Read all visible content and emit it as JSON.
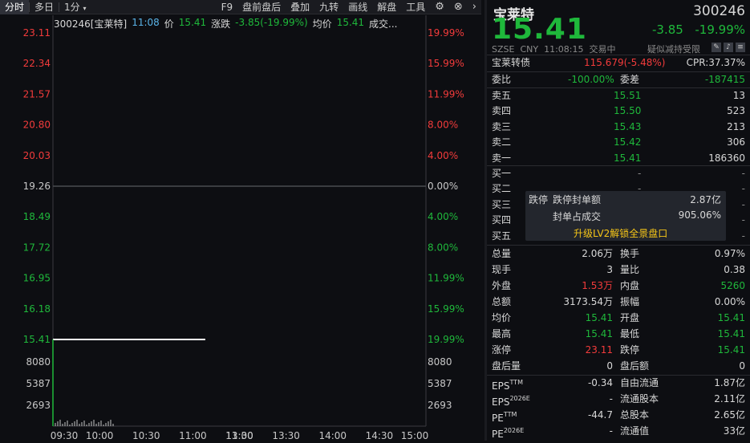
{
  "toolbar": {
    "tabs": [
      "分时",
      "多日",
      "1分"
    ],
    "items": [
      "F9",
      "盘前盘后",
      "叠加",
      "九转",
      "画线",
      "解盘",
      "工具"
    ]
  },
  "info_bar": {
    "name": "300246[宝莱特]",
    "time": "11:08",
    "price_label": "价",
    "price": "15.41",
    "change_label": "涨跌",
    "change": "-3.85(-19.99%)",
    "avg_label": "均价",
    "avg": "15.41",
    "vol_label": "成交..."
  },
  "chart_data": {
    "type": "line",
    "price_ticks": [
      "23.11",
      "22.34",
      "21.57",
      "20.80",
      "20.03",
      "19.26",
      "18.49",
      "17.72",
      "16.95",
      "16.18",
      "15.41"
    ],
    "pct_ticks": [
      "19.99%",
      "15.99%",
      "11.99%",
      "8.00%",
      "4.00%",
      "0.00%",
      "4.00%",
      "8.00%",
      "11.99%",
      "15.99%",
      "19.99%"
    ],
    "vol_ticks": [
      "8080",
      "5387",
      "2693"
    ],
    "x_ticks": [
      "09:30",
      "10:00",
      "10:30",
      "11:00",
      "11:30",
      "13:00",
      "13:30",
      "14:00",
      "14:30",
      "15:00"
    ],
    "prev_close": 19.26,
    "ylim": [
      15.41,
      23.11
    ],
    "series": [
      {
        "values_x": [
          "09:30",
          "11:08"
        ],
        "values": [
          15.41,
          15.41
        ]
      }
    ]
  },
  "quote": {
    "name": "宝莱特",
    "code": "300246",
    "price": "15.41",
    "change": "-3.85",
    "change_pct": "-19.99%",
    "market": "SZSE",
    "currency": "CNY",
    "time": "11:08:15",
    "status": "交易中",
    "note": "疑似减持受限"
  },
  "bond": {
    "name": "宝莱转债",
    "value": "115.679(-5.48%)",
    "cpr": "CPR:37.37%"
  },
  "commission": {
    "ratio_label": "委比",
    "ratio": "-100.00%",
    "diff_label": "委差",
    "diff": "-187415"
  },
  "asks": [
    {
      "label": "卖五",
      "price": "15.51",
      "vol": "13"
    },
    {
      "label": "卖四",
      "price": "15.50",
      "vol": "523"
    },
    {
      "label": "卖三",
      "price": "15.43",
      "vol": "213"
    },
    {
      "label": "卖二",
      "price": "15.42",
      "vol": "306"
    },
    {
      "label": "卖一",
      "price": "15.41",
      "vol": "186360"
    }
  ],
  "bids": [
    {
      "label": "买一",
      "price": "-",
      "vol": "-"
    },
    {
      "label": "买二",
      "price": "-",
      "vol": "-"
    },
    {
      "label": "买三",
      "price": "-",
      "vol": "-"
    },
    {
      "label": "买四",
      "price": "-",
      "vol": "-"
    },
    {
      "label": "买五",
      "price": "-",
      "vol": "-"
    }
  ],
  "popup": {
    "title": "跌停",
    "row1_label": "跌停封单额",
    "row1_value": "2.87亿",
    "row2_label": "封单占成交",
    "row2_value": "905.06%",
    "upgrade": "升级LV2解锁全景盘口"
  },
  "stats": [
    {
      "l1": "总量",
      "v1": "2.06万",
      "l2": "换手",
      "v2": "0.97%"
    },
    {
      "l1": "现手",
      "v1": "3",
      "l2": "量比",
      "v2": "0.38"
    },
    {
      "l1": "外盘",
      "v1": "1.53万",
      "l2": "内盘",
      "v2": "5260"
    },
    {
      "l1": "总额",
      "v1": "3173.54万",
      "l2": "振幅",
      "v2": "0.00%"
    },
    {
      "l1": "均价",
      "v1": "15.41",
      "l2": "开盘",
      "v2": "15.41"
    },
    {
      "l1": "最高",
      "v1": "15.41",
      "l2": "最低",
      "v2": "15.41"
    },
    {
      "l1": "涨停",
      "v1": "23.11",
      "l2": "跌停",
      "v2": "15.41"
    },
    {
      "l1": "盘后量",
      "v1": "0",
      "l2": "盘后额",
      "v2": "0"
    }
  ],
  "fund": [
    {
      "l1": "EPS",
      "s1": "TTM",
      "v1": "-0.34",
      "l2": "自由流通",
      "v2": "1.87亿"
    },
    {
      "l1": "EPS",
      "s1": "2026E",
      "v1": "-",
      "l2": "流通股本",
      "v2": "2.11亿"
    },
    {
      "l1": "PE",
      "s1": "TTM",
      "v1": "-44.7",
      "l2": "总股本",
      "v2": "2.65亿"
    },
    {
      "l1": "PE",
      "s1": "2026E",
      "v1": "-",
      "l2": "流通值",
      "v2": "33亿"
    }
  ]
}
